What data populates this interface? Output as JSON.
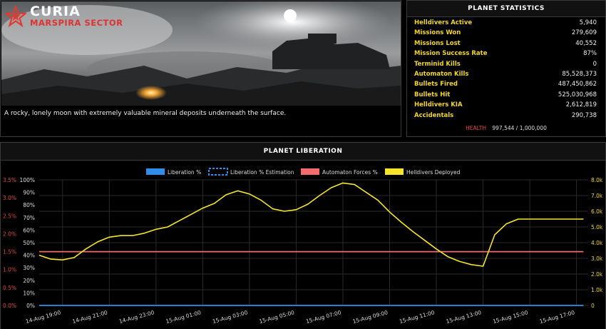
{
  "planet": {
    "name": "CURIA",
    "sector": "MARSPIRA SECTOR",
    "description": "A rocky, lonely moon with extremely valuable mineral deposits underneath the surface."
  },
  "stats": {
    "title": "PLANET STATISTICS",
    "rows": [
      {
        "label": "Helldivers Active",
        "value": "5,940"
      },
      {
        "label": "Missions Won",
        "value": "279,609"
      },
      {
        "label": "Missions Lost",
        "value": "40,552"
      },
      {
        "label": "Mission Success Rate",
        "value": "87%"
      },
      {
        "label": "Terminid Kills",
        "value": "0"
      },
      {
        "label": "Automaton Kills",
        "value": "85,528,373"
      },
      {
        "label": "Bullets Fired",
        "value": "487,450,862"
      },
      {
        "label": "Bullets Hit",
        "value": "525,030,968"
      },
      {
        "label": "Helldivers KIA",
        "value": "2,612,819"
      },
      {
        "label": "Accidentals",
        "value": "290,738"
      }
    ],
    "health_label": "HEALTH",
    "health_value": "997,544 / 1,000,000"
  },
  "liberation": {
    "title": "PLANET LIBERATION"
  },
  "colors": {
    "liberation": "#2f8fe8",
    "estimation": "#2f8fe8",
    "automaton": "#f36b6b",
    "helldivers": "#f5e42a",
    "accent_red": "#d33"
  },
  "chart_data": {
    "type": "line",
    "legend": [
      "Liberation %",
      "Liberation % Estimation",
      "Automaton Forces %",
      "Helldivers Deployed"
    ],
    "legend_placement": "top",
    "x_ticks": [
      "14-Aug 19:00",
      "14-Aug 21:00",
      "14-Aug 23:00",
      "15-Aug 01:00",
      "15-Aug 03:00",
      "15-Aug 05:00",
      "15-Aug 07:00",
      "15-Aug 09:00",
      "15-Aug 11:00",
      "15-Aug 13:00",
      "15-Aug 15:00",
      "15-Aug 17:00"
    ],
    "left_ticks": [
      "0.0%",
      "0.5%",
      "1.0%",
      "1.5%",
      "2.0%",
      "2.5%",
      "3.0%",
      "3.5%"
    ],
    "mid_ticks": [
      "0%",
      "10%",
      "20%",
      "30%",
      "40%",
      "50%",
      "60%",
      "70%",
      "80%",
      "90%",
      "100%"
    ],
    "right_ticks": [
      "0",
      "1.0k",
      "2.0k",
      "3.0k",
      "4.0k",
      "5.0k",
      "6.0k",
      "7.0k",
      "8.0k"
    ],
    "x_range": [
      18,
      41.5
    ],
    "series": [
      {
        "name": "Liberation %",
        "axis": "mid",
        "ylim": [
          0,
          100
        ],
        "x": [
          18,
          41.3
        ],
        "values": [
          0,
          0
        ]
      },
      {
        "name": "Automaton Forces %",
        "axis": "left",
        "ylim": [
          0,
          3.5
        ],
        "x": [
          18,
          41.3
        ],
        "values": [
          1.5,
          1.5
        ]
      },
      {
        "name": "Helldivers Deployed",
        "axis": "right",
        "ylim": [
          0,
          8000
        ],
        "x": [
          18,
          18.5,
          19.0,
          19.5,
          20.0,
          20.5,
          21.0,
          21.5,
          22.0,
          22.5,
          23.0,
          23.5,
          24.0,
          24.5,
          25.0,
          25.5,
          26.0,
          26.5,
          27.0,
          27.5,
          28.0,
          28.5,
          29.0,
          29.5,
          30.0,
          30.5,
          31.0,
          31.5,
          32.0,
          32.5,
          33.0,
          33.5,
          34.0,
          34.5,
          35.0,
          35.5,
          36.0,
          36.5,
          37.0,
          37.5,
          38.0,
          38.5,
          39.0,
          39.5,
          40.0,
          40.5,
          41.0,
          41.3
        ],
        "values": [
          3200,
          2950,
          2900,
          3050,
          3600,
          4050,
          4350,
          4450,
          4450,
          4600,
          4850,
          5000,
          5400,
          5800,
          6200,
          6500,
          7050,
          7300,
          7100,
          6700,
          6150,
          6000,
          6100,
          6450,
          7000,
          7500,
          7800,
          7700,
          7200,
          6700,
          5950,
          5300,
          4700,
          4150,
          3600,
          3100,
          2800,
          2600,
          2500,
          4500,
          5200,
          5500,
          5500,
          5500,
          5500,
          5500,
          5500,
          5500
        ]
      }
    ]
  }
}
